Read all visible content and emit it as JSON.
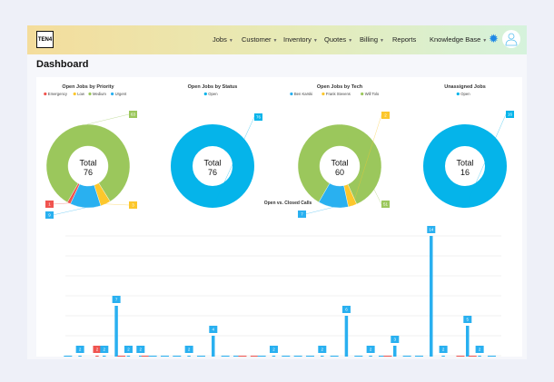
{
  "header": {
    "logo": "TEN4",
    "nav": [
      {
        "label": "Jobs",
        "dropdown": true
      },
      {
        "label": "Customer",
        "dropdown": true
      },
      {
        "label": "Inventory",
        "dropdown": true
      },
      {
        "label": "Quotes",
        "dropdown": true
      },
      {
        "label": "Billing",
        "dropdown": true
      },
      {
        "label": "Reports",
        "dropdown": false
      },
      {
        "label": "Knowledge Base",
        "dropdown": true
      }
    ],
    "icons": [
      "gear-icon",
      "user-avatar-icon"
    ]
  },
  "page_title": "Dashboard",
  "colors": {
    "red": "#f0544f",
    "yellow": "#fcc72c",
    "green": "#9bc75c",
    "blue": "#29b0f0",
    "cyan": "#05b4ea"
  },
  "chart_data": [
    {
      "type": "pie",
      "title": "Open Jobs by Priority",
      "center_label": "Total",
      "total": "76",
      "slices": [
        {
          "name": "Emergency",
          "value": 1,
          "color": "#f0544f"
        },
        {
          "name": "Medium",
          "value": 63,
          "color": "#9bc75c"
        },
        {
          "name": "Low",
          "value": 3,
          "color": "#fcc72c"
        },
        {
          "name": "Urgent",
          "value": 9,
          "color": "#29b0f0"
        }
      ],
      "legend": [
        "Emergency",
        "Low",
        "Medium",
        "Urgent"
      ],
      "legend_colors": [
        "#f0544f",
        "#fcc72c",
        "#9bc75c",
        "#29b0f0"
      ]
    },
    {
      "type": "pie",
      "title": "Open Jobs by Status",
      "center_label": "Total",
      "total": "76",
      "slices": [
        {
          "name": "Open",
          "value": 76,
          "color": "#05b4ea"
        }
      ],
      "legend": [
        "Open"
      ],
      "legend_colors": [
        "#05b4ea"
      ]
    },
    {
      "type": "pie",
      "title": "Open Jobs by Tech",
      "center_label": "Total",
      "total": "60",
      "slices": [
        {
          "name": "Will Tolo",
          "value": 51,
          "color": "#9bc75c"
        },
        {
          "name": "Frank Stevens",
          "value": 2,
          "color": "#fcc72c"
        },
        {
          "name": "Ben Karski",
          "value": 7,
          "color": "#29b0f0"
        }
      ],
      "legend": [
        "Ben Karski",
        "Frank Stevens",
        "Will Tolo"
      ],
      "legend_colors": [
        "#29b0f0",
        "#fcc72c",
        "#9bc75c"
      ]
    },
    {
      "type": "pie",
      "title": "Unassigned Jobs",
      "center_label": "Total",
      "total": "16",
      "slices": [
        {
          "name": "Open",
          "value": 16,
          "color": "#05b4ea"
        }
      ],
      "legend": [
        "Open"
      ],
      "legend_colors": [
        "#05b4ea"
      ]
    },
    {
      "type": "bar",
      "title": "Open vs. Closed Calls",
      "ylim": [
        0,
        14
      ],
      "grid": true,
      "series": [
        {
          "color": "#29b0f0",
          "values": [
            1,
            2,
            0,
            2,
            7,
            2,
            2,
            1,
            1,
            1,
            2,
            1,
            4,
            1,
            1,
            0,
            1,
            2,
            1,
            1,
            1,
            2,
            1,
            6,
            1,
            2,
            1,
            3,
            1,
            1,
            14,
            2,
            0,
            5,
            2,
            1
          ]
        },
        {
          "color": "#f0544f",
          "values": [
            0,
            0,
            2,
            0,
            1,
            0,
            1,
            0,
            0,
            0,
            0,
            0,
            0,
            0,
            1,
            1,
            0,
            0,
            0,
            0,
            0,
            0,
            0,
            0,
            0,
            0,
            1,
            0,
            0,
            0,
            0,
            0,
            1,
            1,
            0,
            0
          ]
        }
      ]
    }
  ]
}
